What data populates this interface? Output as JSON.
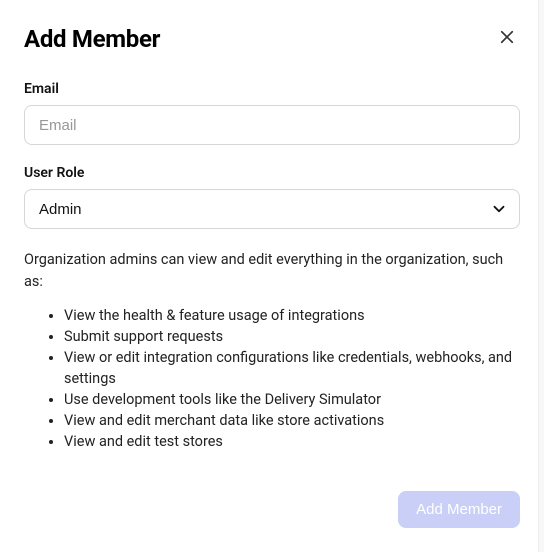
{
  "modal": {
    "title": "Add Member",
    "email": {
      "label": "Email",
      "placeholder": "Email",
      "value": ""
    },
    "role": {
      "label": "User Role",
      "selected": "Admin"
    },
    "description": "Organization admins can view and edit everything in the organization, such as:",
    "permissions": [
      "View the health & feature usage of integrations",
      "Submit support requests",
      "View or edit integration configurations like credentials, webhooks, and settings",
      "Use development tools like the Delivery Simulator",
      "View and edit merchant data like store activations",
      "View and edit test stores"
    ],
    "submit_label": "Add Member"
  }
}
